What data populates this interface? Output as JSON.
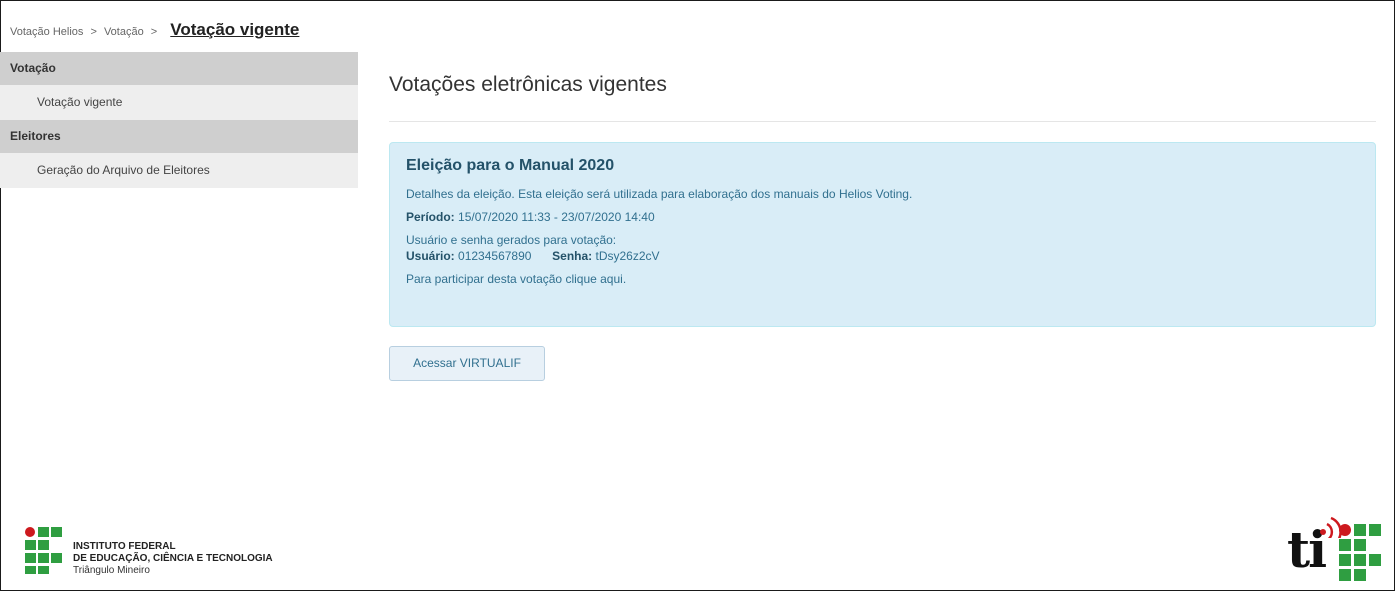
{
  "breadcrumb": {
    "items": [
      "Votação Helios",
      "Votação"
    ],
    "separator": ">",
    "current": "Votação vigente"
  },
  "sidebar": {
    "sections": [
      {
        "header": "Votação",
        "items": [
          "Votação vigente"
        ]
      },
      {
        "header": "Eleitores",
        "items": [
          "Geração do Arquivo de Eleitores"
        ]
      }
    ]
  },
  "main": {
    "title": "Votações eletrônicas vigentes",
    "election": {
      "title": "Eleição para o Manual 2020",
      "description": "Detalhes da eleição. Esta eleição será utilizada para elaboração dos manuais do Helios Voting.",
      "period_label": "Período:",
      "period_value": "15/07/2020 11:33 - 23/07/2020 14:40",
      "credentials_intro": "Usuário e senha gerados para votação:",
      "user_label": "Usuário:",
      "user_value": "01234567890",
      "password_label": "Senha:",
      "password_value": "tDsy26z2cV",
      "participate_text": "Para participar desta votação",
      "participate_link": "clique aqui."
    },
    "button_label": "Acessar VIRTUALIF"
  },
  "footer": {
    "institute_line1": "INSTITUTO FEDERAL",
    "institute_line2": "DE EDUCAÇÃO, CIÊNCIA E TECNOLOGIA",
    "institute_line3": "Triângulo Mineiro",
    "ti_logo_text": "ti"
  },
  "colors": {
    "sidebar_header_bg": "#cfcfcf",
    "sidebar_bg": "#eeeeee",
    "info_bg": "#d9edf7",
    "info_border": "#bce8f1",
    "info_text": "#31708f",
    "if_green": "#2f9e41",
    "if_red": "#cd191e"
  }
}
